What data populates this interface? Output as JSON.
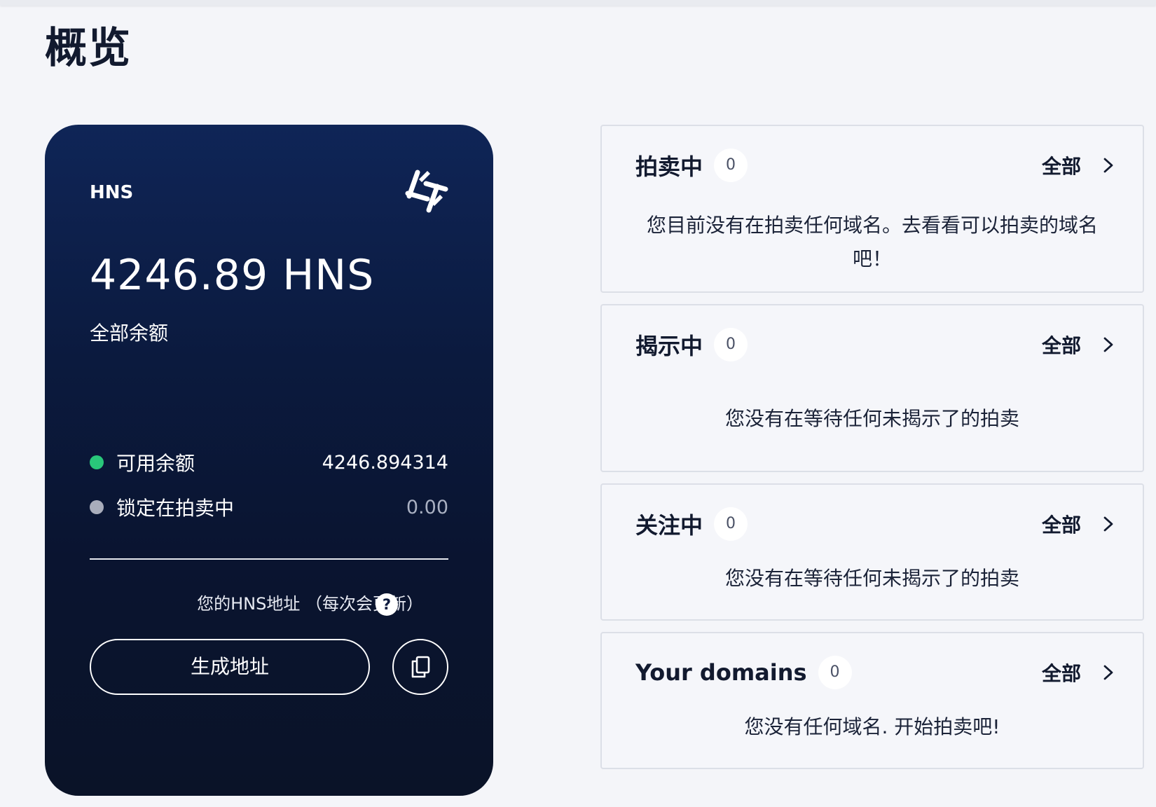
{
  "page": {
    "title": "概览"
  },
  "wallet": {
    "currency": "HNS",
    "total": "4246.89 HNS",
    "total_label": "全部余额",
    "available_label": "可用余额",
    "available_value": "4246.894314",
    "locked_label": "锁定在拍卖中",
    "locked_value": "0.00",
    "address_label": "您的HNS地址 （每次会更新）",
    "help_glyph": "?",
    "generate_button": "生成地址",
    "icons": {
      "logo": "handshake-logo-icon",
      "help": "help-icon",
      "copy": "copy-icon"
    },
    "colors": {
      "available_dot": "#29c77a",
      "locked_dot": "#a9adbb"
    }
  },
  "panels": [
    {
      "title": "拍卖中",
      "count": "0",
      "view_all": "全部",
      "message": "您目前没有在拍卖任何域名。去看看可以拍卖的域名吧！"
    },
    {
      "title": "揭示中",
      "count": "0",
      "view_all": "全部",
      "message": "您没有在等待任何未揭示了的拍卖"
    },
    {
      "title": "关注中",
      "count": "0",
      "view_all": "全部",
      "message": "您没有在等待任何未揭示了的拍卖"
    },
    {
      "title": "Your domains",
      "count": "0",
      "view_all": "全部",
      "message": "您没有任何域名. 开始拍卖吧!"
    }
  ]
}
